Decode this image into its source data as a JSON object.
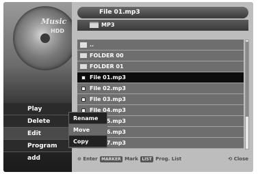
{
  "left_panel": {
    "title": "Music",
    "source": "HDD",
    "menu": [
      {
        "label": "Play"
      },
      {
        "label": "Delete"
      },
      {
        "label": "Edit"
      },
      {
        "label": "Program add"
      }
    ]
  },
  "header": {
    "title": "File 01.mp3",
    "folder": "MP3"
  },
  "files": [
    {
      "label": "..",
      "icon": "folder-up-icon"
    },
    {
      "label": "FOLDER 00",
      "icon": "folder-icon"
    },
    {
      "label": "FOLDER 01",
      "icon": "folder-icon"
    },
    {
      "label": "File 01.mp3",
      "icon": "file-icon",
      "selected": true
    },
    {
      "label": "File 02.mp3",
      "icon": "file-icon"
    },
    {
      "label": "File 03.mp3",
      "icon": "file-icon"
    },
    {
      "label": "File 04.mp3",
      "icon": "file-icon"
    },
    {
      "label": "File 05.mp3",
      "icon": "file-icon"
    },
    {
      "label": "File 06.mp3",
      "icon": "file-icon"
    },
    {
      "label": "File 07.mp3",
      "icon": "file-icon"
    }
  ],
  "popup": {
    "items": [
      {
        "label": "Rename"
      },
      {
        "label": "Move"
      },
      {
        "label": "Copy"
      }
    ]
  },
  "footer": {
    "enter": "Enter",
    "marker_key": "MARKER",
    "mark": "Mark",
    "list_key": "LIST",
    "prog_list": "Prog. List",
    "close": "Close"
  },
  "colors": {
    "selection": "#0d0d0d",
    "row": "#6e6e6e",
    "popup_active": "#6a6a6a"
  }
}
